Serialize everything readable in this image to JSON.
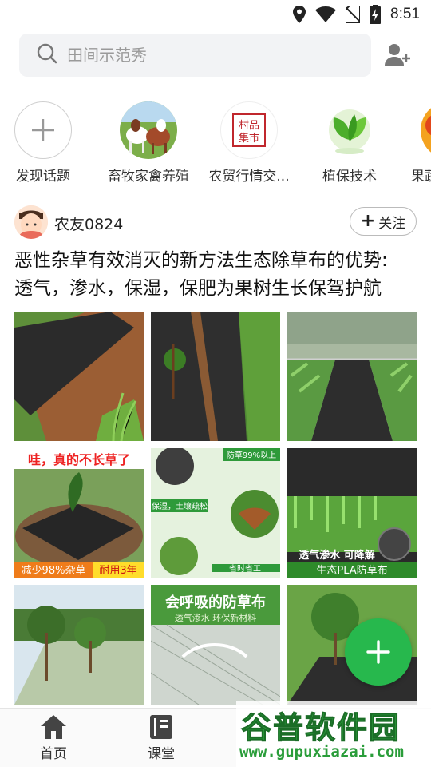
{
  "status_bar": {
    "time": "8:51"
  },
  "search": {
    "placeholder": "田间示范秀"
  },
  "topics": [
    {
      "label": "发现话题",
      "icon": "plus-icon"
    },
    {
      "label": "畜牧家禽养殖",
      "icon": "livestock-image"
    },
    {
      "label": "农贸行情交...",
      "icon": "market-logo-image",
      "logo_text": "村品集市"
    },
    {
      "label": "植保技术",
      "icon": "green-leaves-image"
    },
    {
      "label": "果蔬",
      "icon": "fruit-image"
    }
  ],
  "post": {
    "username": "农友0824",
    "follow_label": "关注",
    "title_line1": "恶性杂草有效消灭的新方法生态除草布的优势:",
    "title_line2": "透气，渗水，保湿，保肥为果树生长保驾护航",
    "photos": [
      {
        "name": "weed-cloth-photo-1"
      },
      {
        "name": "weed-cloth-photo-2"
      },
      {
        "name": "weed-cloth-photo-3"
      },
      {
        "name": "weed-cloth-photo-4",
        "caption_top": "哇，真的不长草了",
        "caption_bottom_left": "减少98%杂草",
        "caption_bottom_right": "耐用3年"
      },
      {
        "name": "weed-cloth-photo-5",
        "badge1": "防草99%以上",
        "badge2": "保湿，土壤疏松",
        "badge3": "省时省工"
      },
      {
        "name": "weed-cloth-photo-6",
        "caption1": "透气渗水 可降解",
        "caption2": "生态PLA防草布"
      },
      {
        "name": "weed-cloth-photo-7"
      },
      {
        "name": "weed-cloth-photo-8",
        "caption1": "会呼吸的防草布",
        "caption2": "透气渗水 环保新材料"
      },
      {
        "name": "weed-cloth-photo-9"
      }
    ]
  },
  "bottom_nav": [
    {
      "label": "首页",
      "icon": "home-icon"
    },
    {
      "label": "课堂",
      "icon": "book-icon"
    }
  ],
  "watermark": {
    "title": "谷普软件园",
    "url": "www.gupuxiazai.com"
  },
  "colors": {
    "accent_green": "#27b84d",
    "search_bg": "#f2f3f5"
  }
}
